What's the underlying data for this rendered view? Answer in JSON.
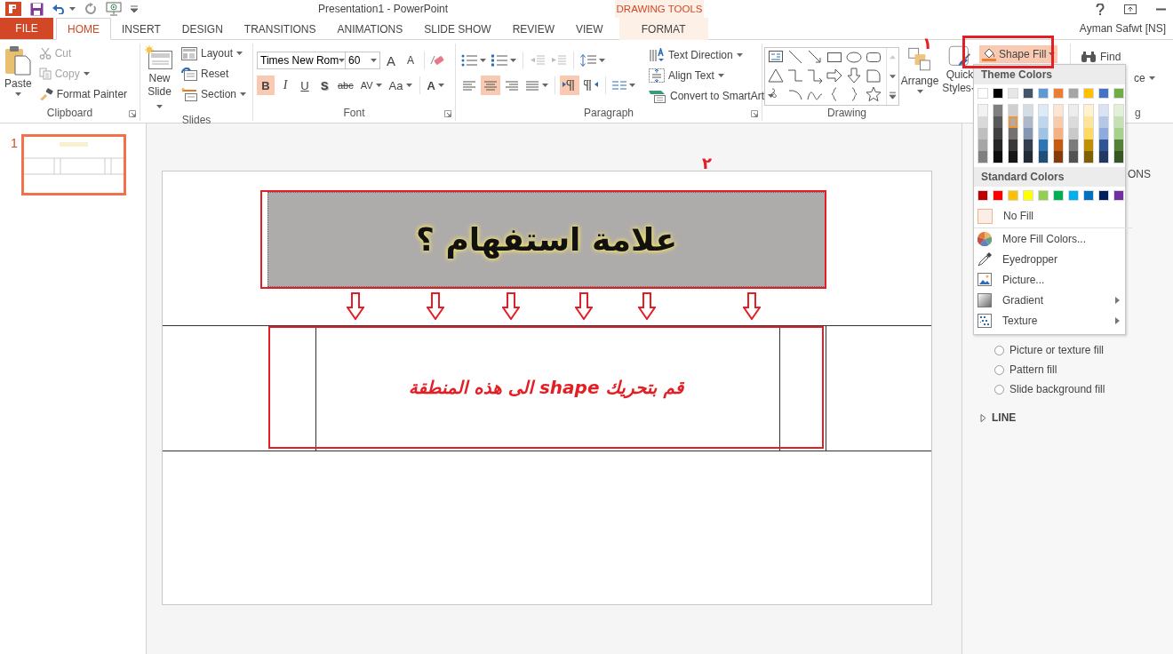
{
  "title_bar": {
    "title": "Presentation1 - PowerPoint",
    "context_label": "DRAWING TOOLS"
  },
  "tabs": [
    {
      "label": "FILE",
      "kind": "file",
      "selected": false
    },
    {
      "label": "HOME",
      "kind": "main",
      "selected": true
    },
    {
      "label": "INSERT",
      "kind": "main",
      "selected": false
    },
    {
      "label": "DESIGN",
      "kind": "main",
      "selected": false
    },
    {
      "label": "TRANSITIONS",
      "kind": "main",
      "selected": false
    },
    {
      "label": "ANIMATIONS",
      "kind": "main",
      "selected": false
    },
    {
      "label": "SLIDE SHOW",
      "kind": "main",
      "selected": false
    },
    {
      "label": "REVIEW",
      "kind": "main",
      "selected": false
    },
    {
      "label": "VIEW",
      "kind": "main",
      "selected": false
    },
    {
      "label": "FORMAT",
      "kind": "context",
      "selected": false
    }
  ],
  "user": "Ayman Safwt [NS]",
  "ribbon": {
    "clipboard": {
      "label": "Clipboard",
      "paste": "Paste",
      "items": [
        {
          "label": "Cut",
          "kind": "cut",
          "disabled": true
        },
        {
          "label": "Copy",
          "kind": "copy",
          "disabled": true
        },
        {
          "label": "Format Painter",
          "kind": "painter",
          "disabled": false
        }
      ]
    },
    "slides": {
      "label": "Slides",
      "new_slide": "New Slide",
      "items": [
        {
          "label": "Layout",
          "kind": "layout"
        },
        {
          "label": "Reset",
          "kind": "reset"
        },
        {
          "label": "Section",
          "kind": "section"
        }
      ]
    },
    "font": {
      "label": "Font",
      "font_name": "Times New Rom",
      "font_size": "60",
      "size_buttons": [
        {
          "label": "A",
          "kind": "grow"
        },
        {
          "label": "A",
          "kind": "shrink"
        }
      ],
      "format_buttons": [
        {
          "label": "B",
          "kind": "bold",
          "selected": true
        },
        {
          "label": "I",
          "kind": "italic",
          "selected": false
        },
        {
          "label": "U",
          "kind": "underline",
          "selected": false
        },
        {
          "label": "S",
          "kind": "shadow",
          "selected": false
        },
        {
          "label": "abc",
          "kind": "strike",
          "selected": false
        },
        {
          "label": "AV",
          "kind": "spacing",
          "selected": false
        },
        {
          "label": "Aa",
          "kind": "case",
          "selected": false
        },
        {
          "label": "A",
          "kind": "color",
          "selected": false
        }
      ]
    },
    "paragraph": {
      "label": "Paragraph",
      "indent_buttons": [
        {
          "kind": "decrease",
          "disabled": true
        },
        {
          "kind": "increase",
          "disabled": true
        }
      ],
      "alignments": [
        {
          "kind": "left",
          "selected": false
        },
        {
          "kind": "center",
          "selected": true
        },
        {
          "kind": "right",
          "selected": false
        },
        {
          "kind": "justify",
          "selected": false
        }
      ],
      "directions": [
        {
          "kind": "ltr",
          "selected": true
        },
        {
          "kind": "rtl",
          "selected": false
        }
      ],
      "commands": [
        {
          "label": "Text Direction",
          "kind": "direction"
        },
        {
          "label": "Align Text",
          "kind": "align"
        },
        {
          "label": "Convert to SmartArt",
          "kind": "smartart"
        }
      ]
    },
    "drawing": {
      "label": "Drawing",
      "arrange": "Arrange",
      "quick_styles": "Quick Styles",
      "shape_fill": "Shape Fill"
    },
    "editing": {
      "find": "Find",
      "fragment": "ce",
      "label_fragment": "g"
    }
  },
  "callout_marks": [
    "١",
    "٢"
  ],
  "shape_fill_menu": {
    "theme_header": "Theme Colors",
    "theme_colors": [
      {
        "color": "#ffffff",
        "selected": false,
        "shades": [
          {
            "color": "#f2f2f2",
            "selected": false
          },
          {
            "color": "#d9d9d9",
            "selected": false
          },
          {
            "color": "#bfbfbf",
            "selected": false
          },
          {
            "color": "#a6a6a6",
            "selected": false
          },
          {
            "color": "#808080",
            "selected": false
          }
        ]
      },
      {
        "color": "#000000",
        "selected": false,
        "shades": [
          {
            "color": "#7f7f7f",
            "selected": false
          },
          {
            "color": "#595959",
            "selected": false
          },
          {
            "color": "#404040",
            "selected": false
          },
          {
            "color": "#262626",
            "selected": false
          },
          {
            "color": "#0d0d0d",
            "selected": false
          }
        ]
      },
      {
        "color": "#e7e6e6",
        "selected": false,
        "shades": [
          {
            "color": "#d0cece",
            "selected": false
          },
          {
            "color": "#aeabab",
            "selected": true
          },
          {
            "color": "#757171",
            "selected": false
          },
          {
            "color": "#3a3838",
            "selected": false
          },
          {
            "color": "#171616",
            "selected": false
          }
        ]
      },
      {
        "color": "#44546a",
        "selected": false,
        "shades": [
          {
            "color": "#d6dce4",
            "selected": false
          },
          {
            "color": "#adb9ca",
            "selected": false
          },
          {
            "color": "#8496b0",
            "selected": false
          },
          {
            "color": "#333f4f",
            "selected": false
          },
          {
            "color": "#222a35",
            "selected": false
          }
        ]
      },
      {
        "color": "#5b9bd5",
        "selected": false,
        "shades": [
          {
            "color": "#deebf6",
            "selected": false
          },
          {
            "color": "#bdd7ee",
            "selected": false
          },
          {
            "color": "#9dc3e6",
            "selected": false
          },
          {
            "color": "#2e75b5",
            "selected": false
          },
          {
            "color": "#1f4e79",
            "selected": false
          }
        ]
      },
      {
        "color": "#ed7d31",
        "selected": false,
        "shades": [
          {
            "color": "#fbe5d5",
            "selected": false
          },
          {
            "color": "#f7cbac",
            "selected": false
          },
          {
            "color": "#f4b183",
            "selected": false
          },
          {
            "color": "#c55a11",
            "selected": false
          },
          {
            "color": "#843c0b",
            "selected": false
          }
        ]
      },
      {
        "color": "#a5a5a5",
        "selected": false,
        "shades": [
          {
            "color": "#ededed",
            "selected": false
          },
          {
            "color": "#dbdbdb",
            "selected": false
          },
          {
            "color": "#c9c9c9",
            "selected": false
          },
          {
            "color": "#7b7b7b",
            "selected": false
          },
          {
            "color": "#525252",
            "selected": false
          }
        ]
      },
      {
        "color": "#ffc000",
        "selected": false,
        "shades": [
          {
            "color": "#fff2cc",
            "selected": false
          },
          {
            "color": "#fee599",
            "selected": false
          },
          {
            "color": "#ffd966",
            "selected": false
          },
          {
            "color": "#bf9000",
            "selected": false
          },
          {
            "color": "#7f6000",
            "selected": false
          }
        ]
      },
      {
        "color": "#4472c4",
        "selected": false,
        "shades": [
          {
            "color": "#dae3f3",
            "selected": false
          },
          {
            "color": "#b4c7e7",
            "selected": false
          },
          {
            "color": "#8faadc",
            "selected": false
          },
          {
            "color": "#2f5597",
            "selected": false
          },
          {
            "color": "#1f3864",
            "selected": false
          }
        ]
      },
      {
        "color": "#70ad47",
        "selected": false,
        "shades": [
          {
            "color": "#e2efd9",
            "selected": false
          },
          {
            "color": "#c5e0b3",
            "selected": false
          },
          {
            "color": "#a8d08d",
            "selected": false
          },
          {
            "color": "#538135",
            "selected": false
          },
          {
            "color": "#375623",
            "selected": false
          }
        ]
      }
    ],
    "standard_header": "Standard Colors",
    "standard_colors": [
      {
        "color": "#c00000",
        "selected": false
      },
      {
        "color": "#ff0000",
        "selected": false
      },
      {
        "color": "#ffc000",
        "selected": false
      },
      {
        "color": "#ffff00",
        "selected": false
      },
      {
        "color": "#92d050",
        "selected": false
      },
      {
        "color": "#00b050",
        "selected": false
      },
      {
        "color": "#00b0f0",
        "selected": false
      },
      {
        "color": "#0070c0",
        "selected": false
      },
      {
        "color": "#002060",
        "selected": false
      },
      {
        "color": "#7030a0",
        "selected": false
      }
    ],
    "no_fill": "No Fill",
    "items": [
      {
        "label": "More Fill Colors...",
        "kind": "colors",
        "submenu": false
      },
      {
        "label": "Eyedropper",
        "kind": "eyedropper",
        "submenu": false
      },
      {
        "label": "Picture...",
        "kind": "picture",
        "submenu": false
      },
      {
        "label": "Gradient",
        "kind": "gradient",
        "submenu": true
      },
      {
        "label": "Texture",
        "kind": "texture",
        "submenu": true
      }
    ]
  },
  "thumbnails": [
    {
      "number": "1",
      "selected": true
    }
  ],
  "slide": {
    "title": "علامة استفهام ؟",
    "body": "قم بتحريك shape الى هذه المنطقة"
  },
  "format_pane": {
    "header_fragment": "ONS",
    "fill_options": [
      {
        "label": "Picture or texture fill",
        "selected": false
      },
      {
        "label": "Pattern fill",
        "selected": false
      },
      {
        "label": "Slide background fill",
        "selected": false
      }
    ],
    "sections": [
      {
        "label": "LINE",
        "expanded": false
      }
    ]
  }
}
